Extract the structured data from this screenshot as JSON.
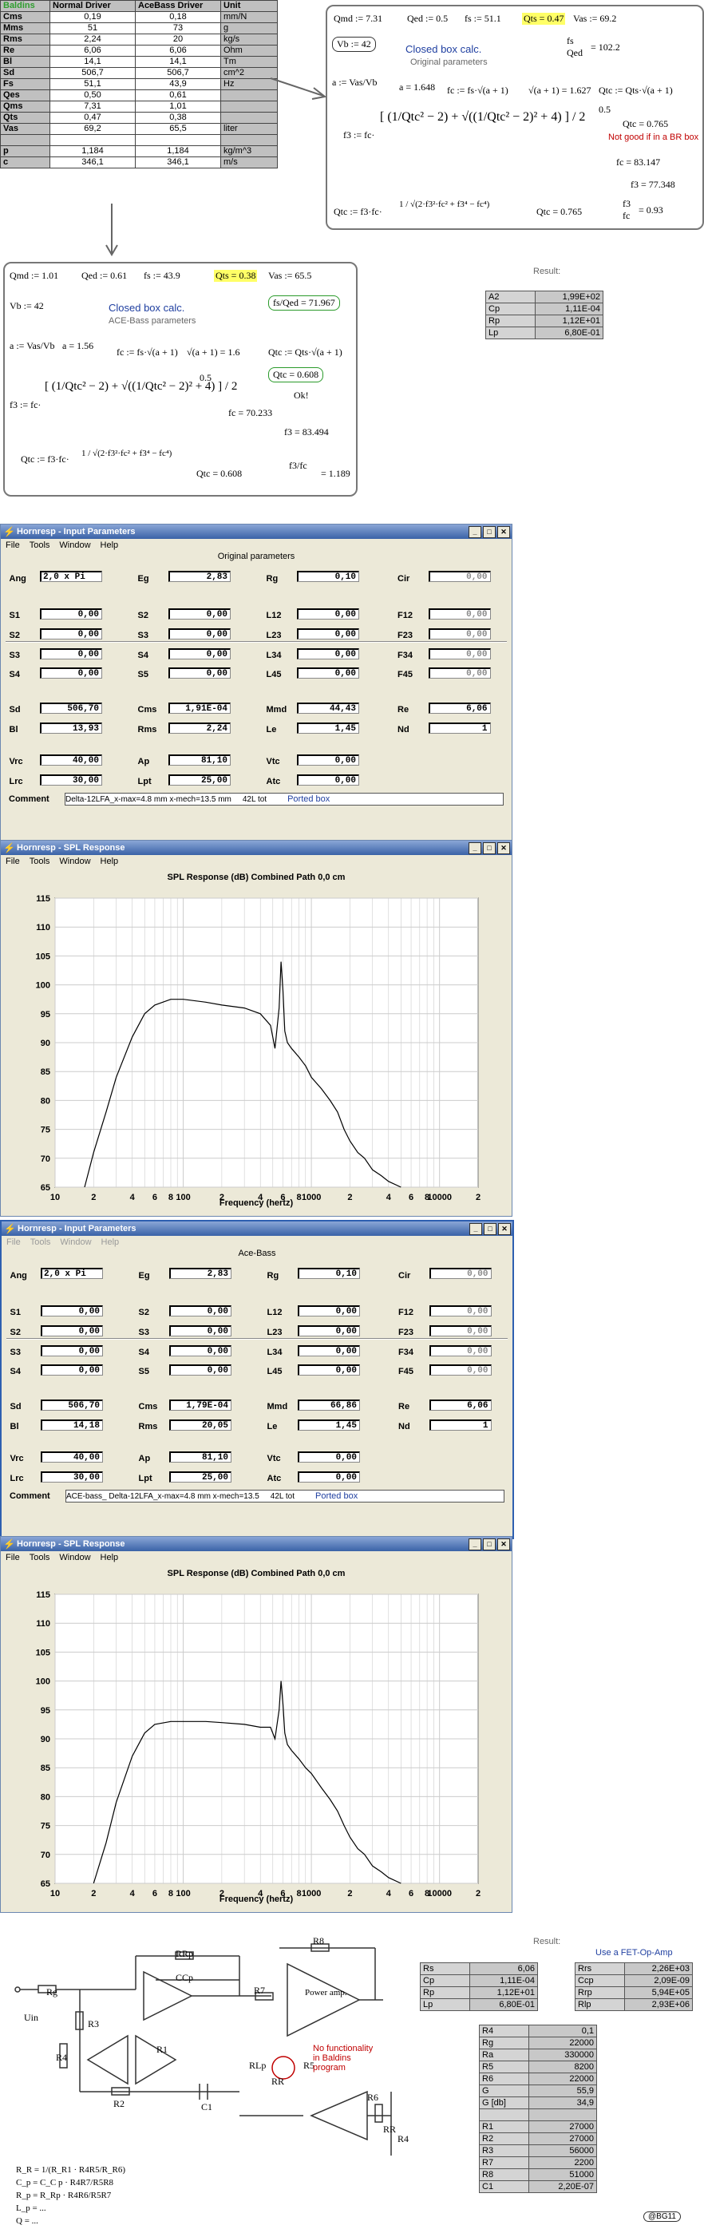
{
  "driver_table": {
    "headers": [
      "Baldins",
      "Normal Driver",
      "AceBass Driver",
      "Unit"
    ],
    "rows": [
      [
        "Cms",
        "0,19",
        "0,18",
        "mm/N"
      ],
      [
        "Mms",
        "51",
        "73",
        "g"
      ],
      [
        "Rms",
        "2,24",
        "20",
        "kg/s"
      ],
      [
        "Re",
        "6,06",
        "6,06",
        "Ohm"
      ],
      [
        "Bl",
        "14,1",
        "14,1",
        "Tm"
      ],
      [
        "Sd",
        "506,7",
        "506,7",
        "cm^2"
      ],
      [
        "Fs",
        "51,1",
        "43,9",
        "Hz"
      ],
      [
        "Qes",
        "0,50",
        "0,61",
        ""
      ],
      [
        "Qms",
        "7,31",
        "1,01",
        ""
      ],
      [
        "Qts",
        "0,47",
        "0,38",
        ""
      ],
      [
        "Vas",
        "69,2",
        "65,5",
        "liter"
      ],
      [
        "",
        "",
        "",
        ""
      ],
      [
        "p",
        "1,184",
        "1,184",
        "kg/m^3"
      ],
      [
        "c",
        "346,1",
        "346,1",
        "m/s"
      ]
    ]
  },
  "calc1": {
    "line1": [
      "Qmd := 7.31",
      "Qed := 0.5",
      "fs := 51.1",
      "Qts = 0.47",
      "Vas := 69.2"
    ],
    "vb": "Vb := 42",
    "title": "Closed box calc.",
    "subtitle": "Original parameters",
    "fs_qed": "= 102.2",
    "alpha": "a = 1.648",
    "fc": "fc := fs·√(a + 1)",
    "sqrt": "√(a + 1) = 1.627",
    "qtc_def": "Qtc := Qts·√(a + 1)",
    "qtc_val": "Qtc = 0.765",
    "warn": "Not good if in a BR box",
    "fc_val": "fc = 83.147",
    "f3_val": "f3 = 77.348",
    "f3_label": "f3 := fc·",
    "qtc_label": "Qtc := f3·fc·",
    "qtc2": "Qtc = 0.765",
    "ratio": "= 0.93",
    "exp": "0.5"
  },
  "calc2": {
    "line1": [
      "Qmd := 1.01",
      "Qed := 0.61",
      "fs := 43.9",
      "Qts = 0.38",
      "Vas := 65.5"
    ],
    "vb": "Vb := 42",
    "title": "Closed box calc.",
    "subtitle": "ACE-Bass parameters",
    "fs_qed": "= 71.967",
    "alpha": "a = 1.56",
    "fc": "fc := fs·√(a + 1)",
    "sqrt": "√(a + 1) = 1.6",
    "qtc_def": "Qtc := Qts·√(a + 1)",
    "qtc_val": "Qtc = 0.608",
    "ok": "Ok!",
    "fc_val": "fc = 70.233",
    "f3_val": "f3 = 83.494",
    "f3_label": "f3 := fc·",
    "qtc_label": "Qtc := f3·fc·",
    "qtc2": "Qtc = 0.608",
    "ratio": "= 1.189",
    "exp": "0.5"
  },
  "result1": {
    "label": "Result:",
    "rows": [
      [
        "A2",
        "1,99E+02"
      ],
      [
        "Cp",
        "1,11E-04"
      ],
      [
        "Rp",
        "1,12E+01"
      ],
      [
        "Lp",
        "6,80E-01"
      ]
    ]
  },
  "win1": {
    "title": "Hornresp - Input Parameters",
    "menu": [
      "File",
      "Tools",
      "Window",
      "Help"
    ],
    "subtitle": "Original parameters",
    "fields": {
      "Ang": "2,0 x Pi",
      "Eg": "2,83",
      "Rg": "0,10",
      "Cir": "0,00",
      "S1": "0,00",
      "S2": "0,00",
      "L12": "0,00",
      "F12": "0,00",
      "S2b": "0,00",
      "S3": "0,00",
      "L23": "0,00",
      "F23": "0,00",
      "S3b": "0,00",
      "S4": "0,00",
      "L34": "0,00",
      "F34": "0,00",
      "S4b": "0,00",
      "S5": "0,00",
      "L45": "0,00",
      "F45": "0,00",
      "Sd": "506,70",
      "Cms": "1,91E-04",
      "Mmd": "44,43",
      "Re": "6,06",
      "Bl": "13,93",
      "Rms": "2,24",
      "Le": "1,45",
      "Nd": "1",
      "Vrc": "40,00",
      "Ap": "81,10",
      "Vtc": "0,00",
      "Lrc": "30,00",
      "Lpt": "25,00",
      "Atc": "0,00"
    },
    "comment_label": "Comment",
    "comment": "Delta-12LFA_x-max=4.8 mm x-mech=13.5 mm",
    "comment_extra": "42L tot",
    "comment_tag": "Ported box"
  },
  "win2": {
    "title": "Hornresp - SPL Response",
    "menu": [
      "File",
      "Tools",
      "Window",
      "Help"
    ],
    "chart_title": "SPL Response (dB)   Combined   Path 0,0 cm",
    "xlabel": "Frequency (hertz)"
  },
  "win3": {
    "title": "Hornresp - Input Parameters",
    "menu": [
      "File",
      "Tools",
      "Window",
      "Help"
    ],
    "subtitle": "Ace-Bass",
    "fields": {
      "Ang": "2,0 x Pi",
      "Eg": "2,83",
      "Rg": "0,10",
      "Cir": "0,00",
      "S1": "0,00",
      "S2": "0,00",
      "L12": "0,00",
      "F12": "0,00",
      "S2b": "0,00",
      "S3": "0,00",
      "L23": "0,00",
      "F23": "0,00",
      "S3b": "0,00",
      "S4": "0,00",
      "L34": "0,00",
      "F34": "0,00",
      "S4b": "0,00",
      "S5": "0,00",
      "L45": "0,00",
      "F45": "0,00",
      "Sd": "506,70",
      "Cms": "1,79E-04",
      "Mmd": "66,86",
      "Re": "6,06",
      "Bl": "14,18",
      "Rms": "20,05",
      "Le": "1,45",
      "Nd": "1",
      "Vrc": "40,00",
      "Ap": "81,10",
      "Vtc": "0,00",
      "Lrc": "30,00",
      "Lpt": "25,00",
      "Atc": "0,00"
    },
    "comment_label": "Comment",
    "comment": "ACE-bass_ Delta-12LFA_x-max=4.8 mm x-mech=13.5",
    "comment_extra": "42L tot",
    "comment_tag": "Ported box"
  },
  "win4": {
    "title": "Hornresp - SPL Response",
    "menu": [
      "File",
      "Tools",
      "Window",
      "Help"
    ],
    "chart_title": "SPL Response (dB)   Combined   Path 0,0 cm",
    "xlabel": "Frequency (hertz)"
  },
  "chart_data": [
    {
      "type": "line",
      "title": "SPL Response (dB)   Combined   Path 0,0 cm",
      "xlabel": "Frequency (hertz)",
      "ylabel": "",
      "xscale": "log",
      "xlim": [
        10,
        20000
      ],
      "ylim": [
        65,
        115
      ],
      "yticks": [
        65,
        70,
        75,
        80,
        85,
        90,
        95,
        100,
        105,
        110,
        115
      ],
      "xtick_labels": [
        "10",
        "2",
        "4",
        "6",
        "8",
        "100",
        "2",
        "4",
        "6",
        "8",
        "1000",
        "2",
        "4",
        "6",
        "8",
        "10000",
        "2"
      ],
      "grid": true,
      "series": [
        {
          "x": [
            17,
            20,
            25,
            30,
            40,
            50,
            60,
            80,
            100,
            150,
            200,
            300,
            400,
            480,
            520,
            560,
            580,
            600,
            620,
            650,
            700,
            800,
            900,
            1000,
            1200,
            1400,
            1600,
            1800,
            2000,
            2300,
            2600,
            3000,
            3500,
            4000,
            5000
          ],
          "y": [
            65,
            71,
            78,
            84,
            91,
            95,
            96.5,
            97.5,
            97.5,
            97,
            96.5,
            96,
            95,
            93,
            89,
            96,
            104,
            99,
            92,
            90,
            89,
            87.5,
            86,
            84,
            82,
            80,
            78,
            75,
            73,
            71,
            70,
            68,
            67,
            66,
            65
          ]
        }
      ]
    },
    {
      "type": "line",
      "title": "SPL Response (dB)   Combined   Path 0,0 cm",
      "xlabel": "Frequency (hertz)",
      "ylabel": "",
      "xscale": "log",
      "xlim": [
        10,
        20000
      ],
      "ylim": [
        65,
        115
      ],
      "yticks": [
        65,
        70,
        75,
        80,
        85,
        90,
        95,
        100,
        105,
        110,
        115
      ],
      "xtick_labels": [
        "10",
        "2",
        "4",
        "6",
        "8",
        "100",
        "2",
        "4",
        "6",
        "8",
        "1000",
        "2",
        "4",
        "6",
        "8",
        "10000",
        "2"
      ],
      "grid": true,
      "series": [
        {
          "x": [
            20,
            25,
            30,
            40,
            50,
            60,
            80,
            100,
            150,
            200,
            300,
            400,
            480,
            520,
            560,
            580,
            600,
            620,
            650,
            700,
            800,
            900,
            1000,
            1200,
            1400,
            1600,
            1800,
            2000,
            2300,
            2600,
            3000,
            3500,
            4000,
            5000
          ],
          "y": [
            65,
            72,
            79,
            87,
            91,
            92.5,
            93,
            93,
            93,
            92.8,
            92.5,
            92,
            92,
            90,
            95,
            100,
            96,
            91,
            89,
            88,
            86.5,
            85,
            84,
            81.5,
            79.5,
            77.5,
            75,
            73,
            71,
            70,
            68,
            67,
            66,
            65
          ]
        }
      ]
    }
  ],
  "schematic": {
    "labels": [
      "Uin",
      "Rg",
      "R3",
      "R4",
      "RRp",
      "CCp",
      "R7",
      "R8",
      "Power amp.",
      "R2",
      "R1",
      "C1",
      "R5",
      "R6",
      "RLp",
      "RR",
      "R4",
      "RR"
    ],
    "note": "No functionality in Baldins program",
    "formulas": [
      "R_R = 1/(R_R1 · R4R5/R_R6)",
      "C_p = C_C p · R4R7/R5R8",
      "R_p = R_Rp · R4R6/R5R7",
      "L_p = ...",
      "Q = ..."
    ],
    "copyright": "@BG11"
  },
  "result2": {
    "label": "Result:",
    "link": "Use a FET-Op-Amp",
    "left": [
      [
        "Rs",
        "6,06"
      ],
      [
        "Cp",
        "1,11E-04"
      ],
      [
        "Rp",
        "1,12E+01"
      ],
      [
        "Lp",
        "6,80E-01"
      ]
    ],
    "right": [
      [
        "Rrs",
        "2,26E+03"
      ],
      [
        "Ccp",
        "2,09E-09"
      ],
      [
        "Rrp",
        "5,94E+05"
      ],
      [
        "Rlp",
        "2,93E+06"
      ]
    ]
  },
  "components": {
    "rows": [
      [
        "R4",
        "0,1"
      ],
      [
        "Rg",
        "22000"
      ],
      [
        "Ra",
        "330000"
      ],
      [
        "R5",
        "8200"
      ],
      [
        "R6",
        "22000"
      ],
      [
        "G",
        "55,9"
      ],
      [
        "G [db]",
        "34,9"
      ],
      [
        "",
        ""
      ],
      [
        "R1",
        "27000"
      ],
      [
        "R2",
        "27000"
      ],
      [
        "R3",
        "56000"
      ],
      [
        "R7",
        "2200"
      ],
      [
        "R8",
        "51000"
      ],
      [
        "C1",
        "2,20E-07"
      ]
    ]
  },
  "colors": {
    "titlebar": "#3a62a7",
    "window_bg": "#ece9d8",
    "highlight": "#ffff66",
    "warn": "#c00000",
    "link": "#1f3fa0"
  }
}
